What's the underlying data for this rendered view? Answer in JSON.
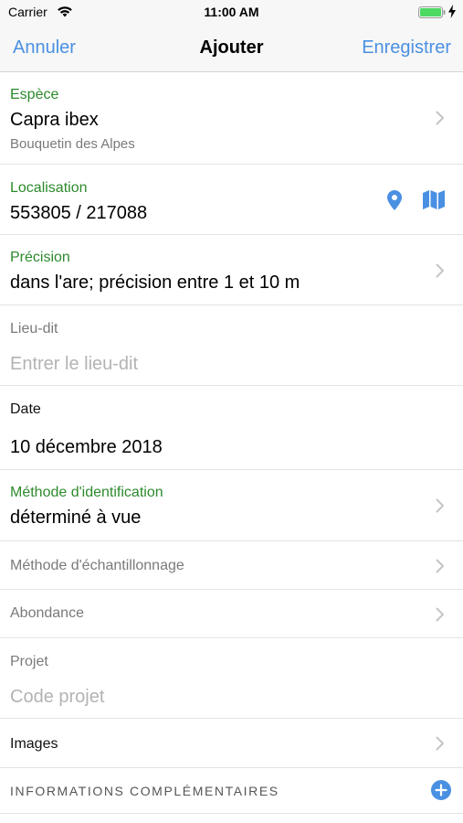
{
  "status_bar": {
    "carrier": "Carrier",
    "time": "11:00 AM"
  },
  "nav": {
    "cancel": "Annuler",
    "title": "Ajouter",
    "save": "Enregistrer"
  },
  "colors": {
    "accent": "#4a90e2",
    "label_green": "#2c8a2c",
    "battery_green": "#4cd964"
  },
  "form": {
    "species": {
      "label": "Espèce",
      "value": "Capra ibex",
      "common_name": "Bouquetin des Alpes"
    },
    "location": {
      "label": "Localisation",
      "value": "553805 / 217088",
      "icons": [
        "location-pin-icon",
        "map-icon"
      ]
    },
    "precision": {
      "label": "Précision",
      "value": "dans l'are; précision entre 1 et 10 m"
    },
    "place": {
      "label": "Lieu-dit",
      "placeholder": "Entrer le lieu-dit"
    },
    "date": {
      "label": "Date",
      "value": "10 décembre 2018"
    },
    "identification": {
      "label": "Méthode d'identification",
      "value": "déterminé à vue"
    },
    "sampling": {
      "label": "Méthode d'échantillonnage"
    },
    "abundance": {
      "label": "Abondance"
    },
    "project": {
      "label": "Projet",
      "placeholder": "Code projet"
    },
    "images": {
      "label": "Images"
    },
    "extra": {
      "label": "INFORMATIONS COMPLÉMENTAIRES",
      "icon": "add-circle-icon"
    }
  }
}
